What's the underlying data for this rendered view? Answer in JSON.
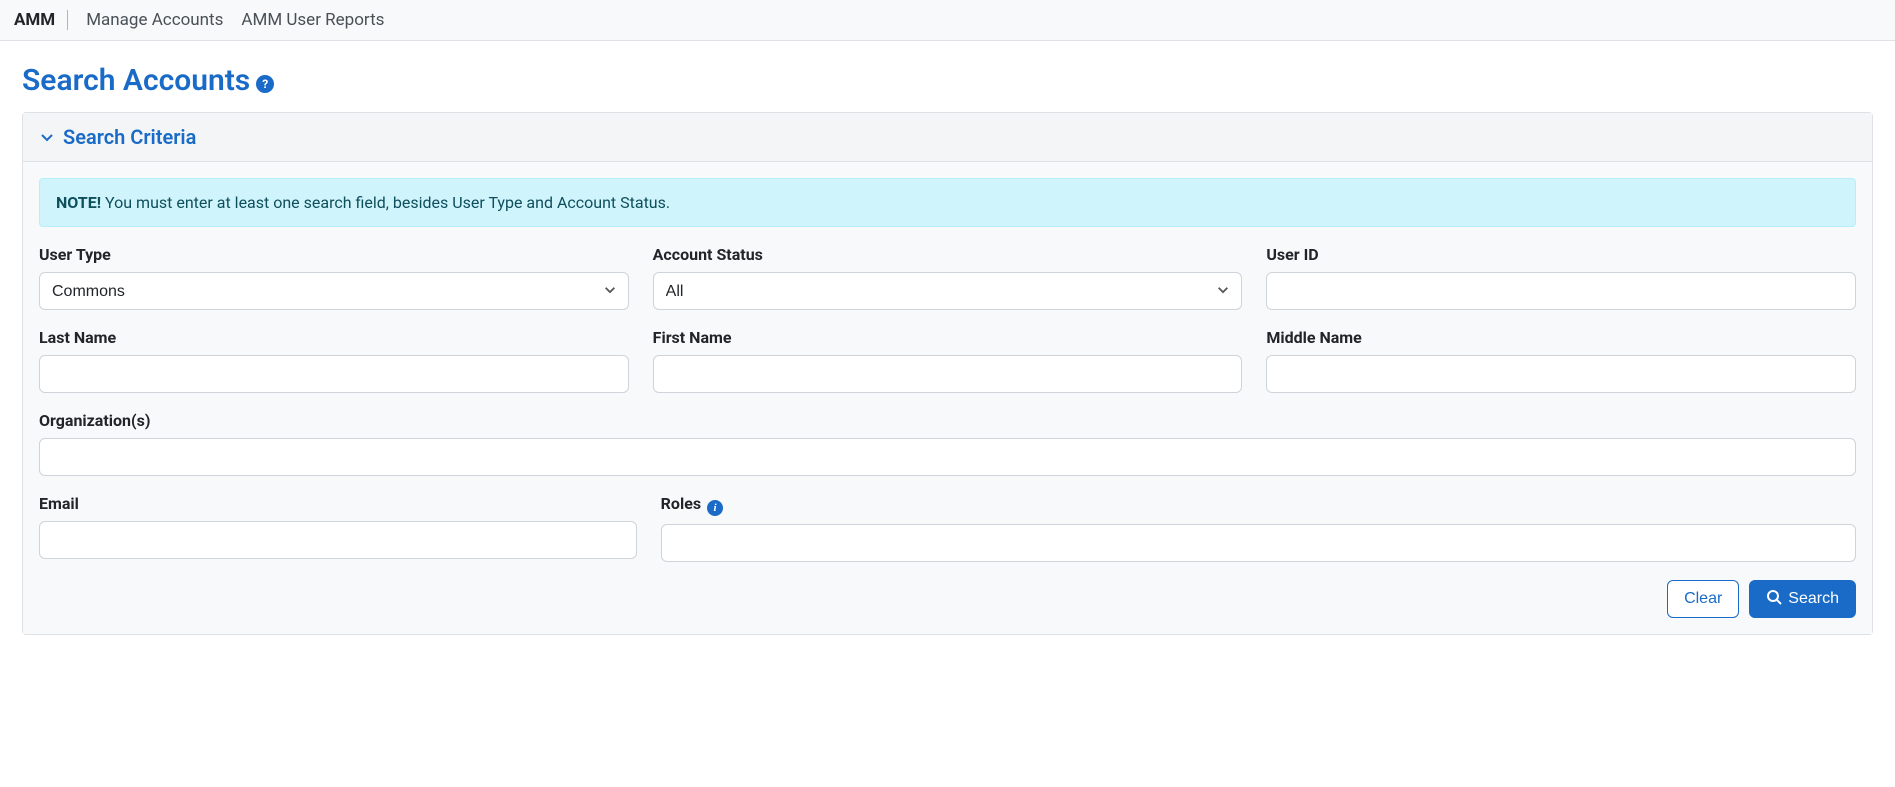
{
  "nav": {
    "brand": "AMM",
    "links": [
      "Manage Accounts",
      "AMM User Reports"
    ]
  },
  "page": {
    "title": "Search Accounts"
  },
  "panel": {
    "title": "Search Criteria"
  },
  "alert": {
    "label": "NOTE!",
    "text": " You must enter at least one search field, besides User Type and Account Status."
  },
  "form": {
    "user_type": {
      "label": "User Type",
      "value": "Commons"
    },
    "account_status": {
      "label": "Account Status",
      "value": "All"
    },
    "user_id": {
      "label": "User ID",
      "value": ""
    },
    "last_name": {
      "label": "Last Name",
      "value": ""
    },
    "first_name": {
      "label": "First Name",
      "value": ""
    },
    "middle_name": {
      "label": "Middle Name",
      "value": ""
    },
    "organizations": {
      "label": "Organization(s)",
      "value": ""
    },
    "email": {
      "label": "Email",
      "value": ""
    },
    "roles": {
      "label": "Roles",
      "value": ""
    }
  },
  "buttons": {
    "clear": "Clear",
    "search": "Search"
  }
}
